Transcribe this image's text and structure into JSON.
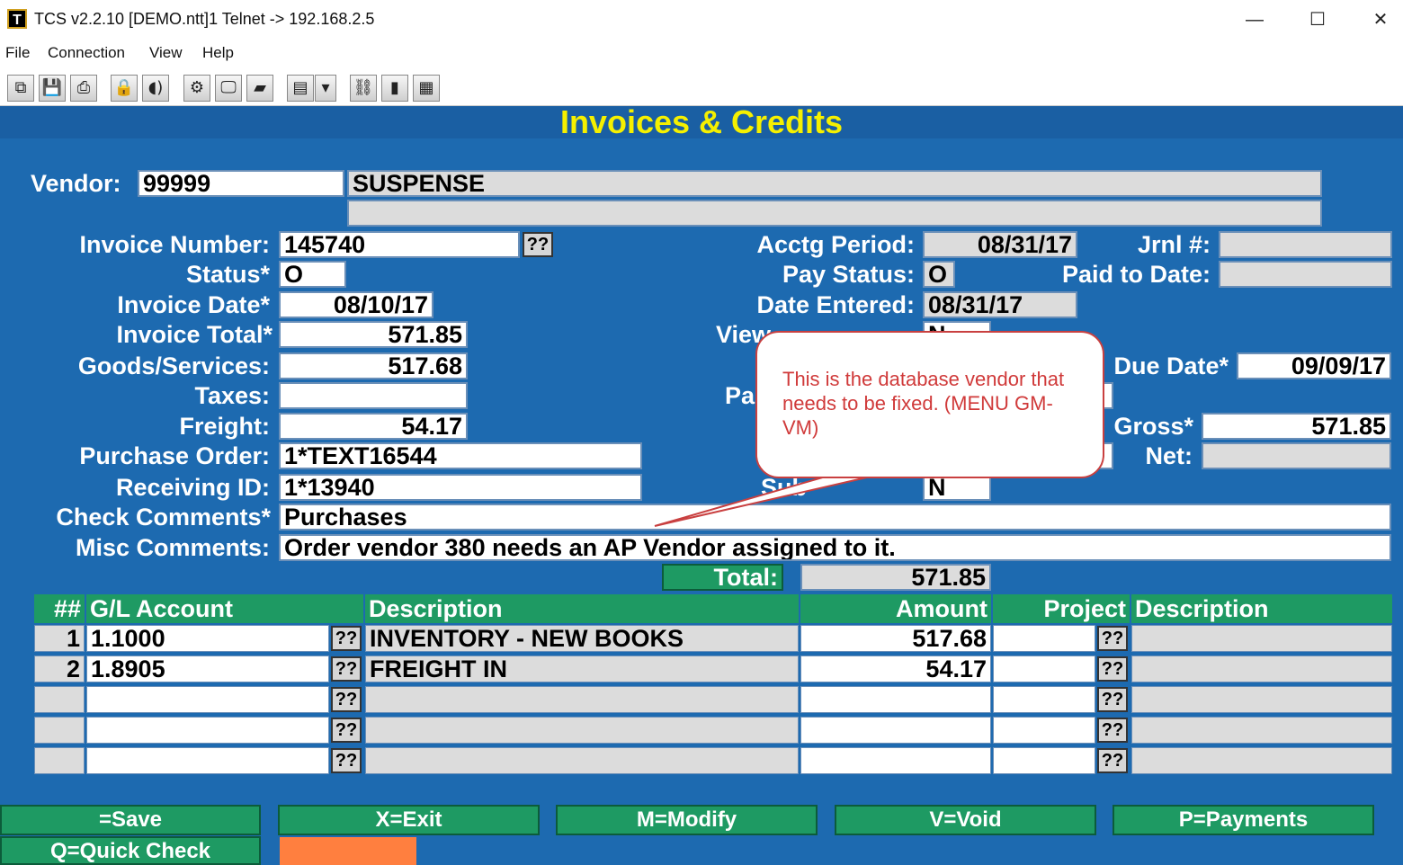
{
  "window": {
    "title": "TCS v2.2.10 [DEMO.ntt]1 Telnet -> 192.168.2.5",
    "icon": "terminal-app-icon",
    "minimize": "—",
    "maximize": "☐",
    "close": "✕"
  },
  "menu": [
    "File",
    "Connection",
    "View",
    "Help"
  ],
  "toolbar": [
    {
      "name": "copy-icon",
      "glyph": "⧉"
    },
    {
      "name": "save-icon",
      "glyph": "💾"
    },
    {
      "name": "print-icon",
      "glyph": "⎙"
    },
    {
      "name": "lock-icon",
      "glyph": "🔒"
    },
    {
      "name": "audio-icon",
      "glyph": "◖)"
    },
    {
      "name": "settings-icon",
      "glyph": "⚙"
    },
    {
      "name": "monitor-icon",
      "glyph": "🖵"
    },
    {
      "name": "book-icon",
      "glyph": "▰"
    },
    {
      "name": "dropdown-icon",
      "glyph": "▤"
    },
    {
      "name": "dropdown-arrow-icon",
      "glyph": "▾"
    },
    {
      "name": "network-icon",
      "glyph": "⛓"
    },
    {
      "name": "chart-icon",
      "glyph": "▮"
    },
    {
      "name": "calculator-icon",
      "glyph": "▦"
    }
  ],
  "form": {
    "title": "Invoices & Credits",
    "vendor_label": "Vendor:",
    "vendor_id": "99999",
    "vendor_name": "SUSPENSE",
    "vendor_line2": "",
    "invoice_number_label": "Invoice Number:",
    "invoice_number": "145740",
    "status_label": "Status*",
    "status": "O",
    "invoice_date_label": "Invoice Date*",
    "invoice_date": "08/10/17",
    "invoice_total_label": "Invoice Total*",
    "invoice_total": "571.85",
    "goods_label": "Goods/Services:",
    "goods": "517.68",
    "taxes_label": "Taxes:",
    "taxes": "",
    "freight_label": "Freight:",
    "freight": "54.17",
    "po_label": "Purchase Order:",
    "po": "1*TEXT16544",
    "receiving_label": "Receiving ID:",
    "receiving": "1*13940",
    "check_comments_label": "Check Comments*",
    "check_comments": "Purchases",
    "misc_comments_label": "Misc Comments:",
    "misc_comments": "Order vendor 380 needs an AP Vendor assigned to it.",
    "acctg_period_label": "Acctg Period:",
    "acctg_period": "08/31/17",
    "jrnl_label": "Jrnl #:",
    "jrnl": "",
    "pay_status_label": "Pay Status:",
    "pay_status": "O",
    "paid_to_date_label": "Paid to Date:",
    "paid_to_date": "",
    "date_entered_label": "Date Entered:",
    "date_entered": "08/31/17",
    "view_label": "View",
    "view_value": "N",
    "due_date_label": "Due Date*",
    "due_date": "09/09/17",
    "pa_label": "Pa",
    "gross_label": "Gross*",
    "gross": "571.85",
    "net_label": "Net:",
    "net": "",
    "subledger_label": "Sub",
    "subledger": "N",
    "total_label": "Total:",
    "total": "571.85"
  },
  "grid": {
    "headers": {
      "num": "##",
      "gl": "G/L Account",
      "desc": "Description",
      "amount": "Amount",
      "project": "Project",
      "pdesc": "Description"
    },
    "rows": [
      {
        "num": "1",
        "gl": "1.1000",
        "desc": "INVENTORY - NEW BOOKS",
        "amount": "517.68",
        "project": "",
        "pdesc": ""
      },
      {
        "num": "2",
        "gl": "1.8905",
        "desc": "FREIGHT IN",
        "amount": "54.17",
        "project": "",
        "pdesc": ""
      },
      {
        "num": "",
        "gl": "",
        "desc": "",
        "amount": "",
        "project": "",
        "pdesc": ""
      },
      {
        "num": "",
        "gl": "",
        "desc": "",
        "amount": "",
        "project": "",
        "pdesc": ""
      },
      {
        "num": "",
        "gl": "",
        "desc": "",
        "amount": "",
        "project": "",
        "pdesc": ""
      }
    ],
    "lookup": "??"
  },
  "fkeys": [
    "=Save",
    "X=Exit",
    "M=Modify",
    "V=Void",
    "P=Payments",
    "Q=Quick Check"
  ],
  "callout": "This is the database vendor that needs to be fixed.  (MENU GM-VM)",
  "colors": {
    "screen": "#1d6ab0",
    "title": "#f5f000",
    "header": "#1e9a63",
    "callout": "#d03a3a",
    "orange": "#ff7f3f"
  }
}
